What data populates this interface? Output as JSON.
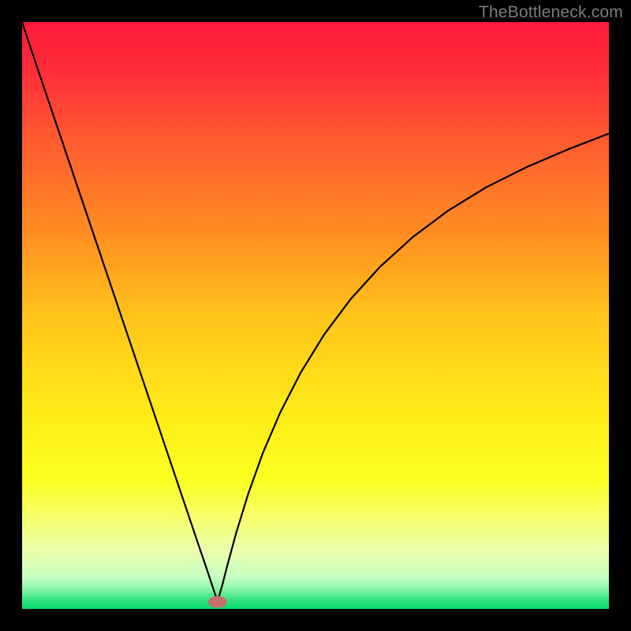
{
  "watermark": "TheBottleneck.com",
  "chart_data": {
    "type": "line",
    "title": "",
    "xlabel": "",
    "ylabel": "",
    "xlim": [
      0,
      100
    ],
    "ylim": [
      0,
      100
    ],
    "grid": false,
    "legend": false,
    "annotations": [],
    "background_gradient": {
      "stops": [
        {
          "offset": 0.0,
          "color": "#ff1a3a"
        },
        {
          "offset": 0.08,
          "color": "#ff2b3a"
        },
        {
          "offset": 0.2,
          "color": "#ff5a2f"
        },
        {
          "offset": 0.35,
          "color": "#ff8a22"
        },
        {
          "offset": 0.5,
          "color": "#ffc31a"
        },
        {
          "offset": 0.65,
          "color": "#ffe817"
        },
        {
          "offset": 0.78,
          "color": "#fbff20"
        },
        {
          "offset": 0.84,
          "color": "#f6ff66"
        },
        {
          "offset": 0.9,
          "color": "#ecffab"
        },
        {
          "offset": 0.945,
          "color": "#c8ffc2"
        },
        {
          "offset": 0.965,
          "color": "#8cf6a8"
        },
        {
          "offset": 0.985,
          "color": "#2fe37d"
        },
        {
          "offset": 1.0,
          "color": "#06d96e"
        }
      ]
    },
    "marker": {
      "x": 33.3,
      "y": 1.2,
      "color": "#c96f6b",
      "rx": 1.6,
      "ry": 1.0
    },
    "series": [
      {
        "name": "curve",
        "color": "#000000",
        "x": [
          0.0,
          2.5,
          5.0,
          7.5,
          10.0,
          12.5,
          15.0,
          17.5,
          20.0,
          22.5,
          25.0,
          27.5,
          30.0,
          31.5,
          32.5,
          33.0,
          33.3,
          33.6,
          34.1,
          35.0,
          36.5,
          38.5,
          41.0,
          44.0,
          47.5,
          51.5,
          56.0,
          61.0,
          66.5,
          72.5,
          79.0,
          86.0,
          93.0,
          100.0
        ],
        "y": [
          100.0,
          92.5,
          85.1,
          77.7,
          70.3,
          62.9,
          55.5,
          48.1,
          40.7,
          33.3,
          25.9,
          18.5,
          11.1,
          6.7,
          3.7,
          2.2,
          1.3,
          2.3,
          4.0,
          7.5,
          13.0,
          19.5,
          26.5,
          33.5,
          40.3,
          46.8,
          52.8,
          58.3,
          63.3,
          67.8,
          71.8,
          75.3,
          78.3,
          81.0
        ]
      }
    ]
  }
}
